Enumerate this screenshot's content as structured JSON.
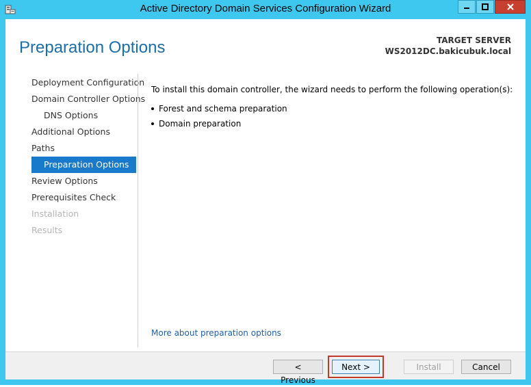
{
  "window": {
    "title": "Active Directory Domain Services Configuration Wizard",
    "accent": "#3fc8ef",
    "close_color": "#c7402f",
    "app_icon": "server-manager-icon",
    "controls": [
      "minimize-icon",
      "maximize-icon",
      "close-icon"
    ]
  },
  "header": {
    "page_title": "Preparation Options",
    "target_label": "TARGET SERVER",
    "target_server": "WS2012DC.bakicubuk.local"
  },
  "nav": {
    "items": [
      {
        "label": "Deployment Configuration",
        "state": "normal"
      },
      {
        "label": "Domain Controller Options",
        "state": "normal"
      },
      {
        "label": "DNS Options",
        "state": "sub"
      },
      {
        "label": "Additional Options",
        "state": "normal"
      },
      {
        "label": "Paths",
        "state": "normal"
      },
      {
        "label": "Preparation Options",
        "state": "active"
      },
      {
        "label": "Review Options",
        "state": "normal"
      },
      {
        "label": "Prerequisites Check",
        "state": "normal"
      },
      {
        "label": "Installation",
        "state": "disabled"
      },
      {
        "label": "Results",
        "state": "disabled"
      }
    ],
    "active_color": "#1979ca"
  },
  "content": {
    "intro": "To install this domain controller, the wizard needs to perform the following operation(s):",
    "operations": [
      "Forest and schema preparation",
      "Domain preparation"
    ],
    "more_link": "More about preparation options"
  },
  "footer": {
    "previous": "< Previous",
    "next": "Next >",
    "install": "Install",
    "cancel": "Cancel",
    "highlight_color": "#c0392b"
  }
}
